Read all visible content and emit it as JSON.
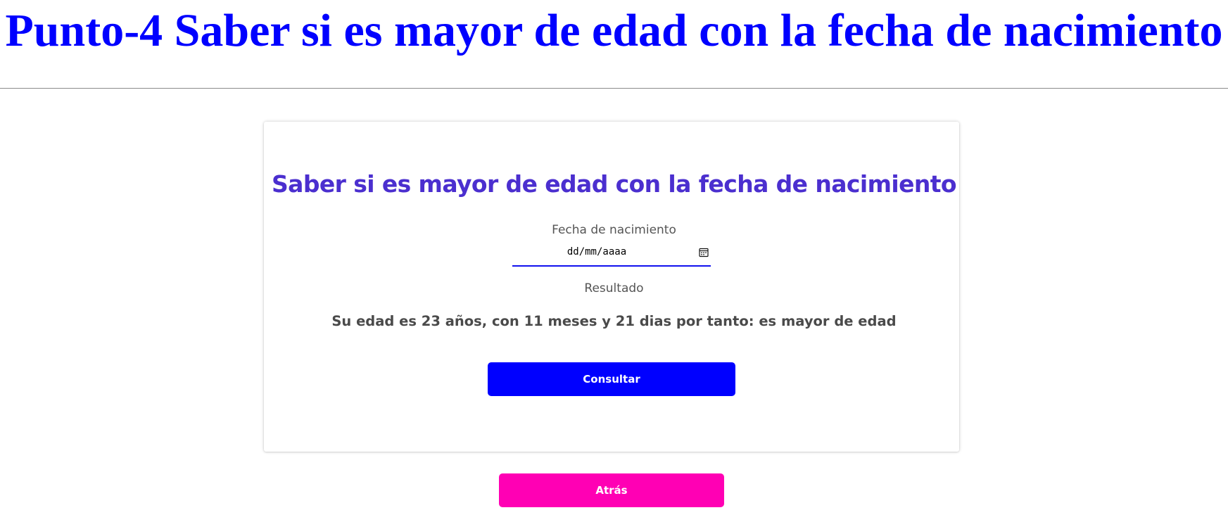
{
  "page": {
    "heading": "Punto-4 Saber si es mayor de edad con la fecha de nacimiento"
  },
  "card": {
    "title": "Saber si es mayor de edad con la fecha de nacimiento",
    "date_label": "Fecha de nacimiento",
    "date_placeholder": "dd/mm/aaaa",
    "date_value": "",
    "date_icon": "calendar-icon",
    "result_label": "Resultado",
    "result_text": "Su edad es 23 años, con 11 meses y 21 dias por tanto: es mayor de edad",
    "consult_button": "Consultar"
  },
  "footer": {
    "back_button": "Atrás"
  },
  "colors": {
    "heading": "#0000ff",
    "card_title": "#4b2fcf",
    "consult_button": "#0000ff",
    "back_button": "#ff00b4",
    "input_underline": "#1111ee"
  }
}
